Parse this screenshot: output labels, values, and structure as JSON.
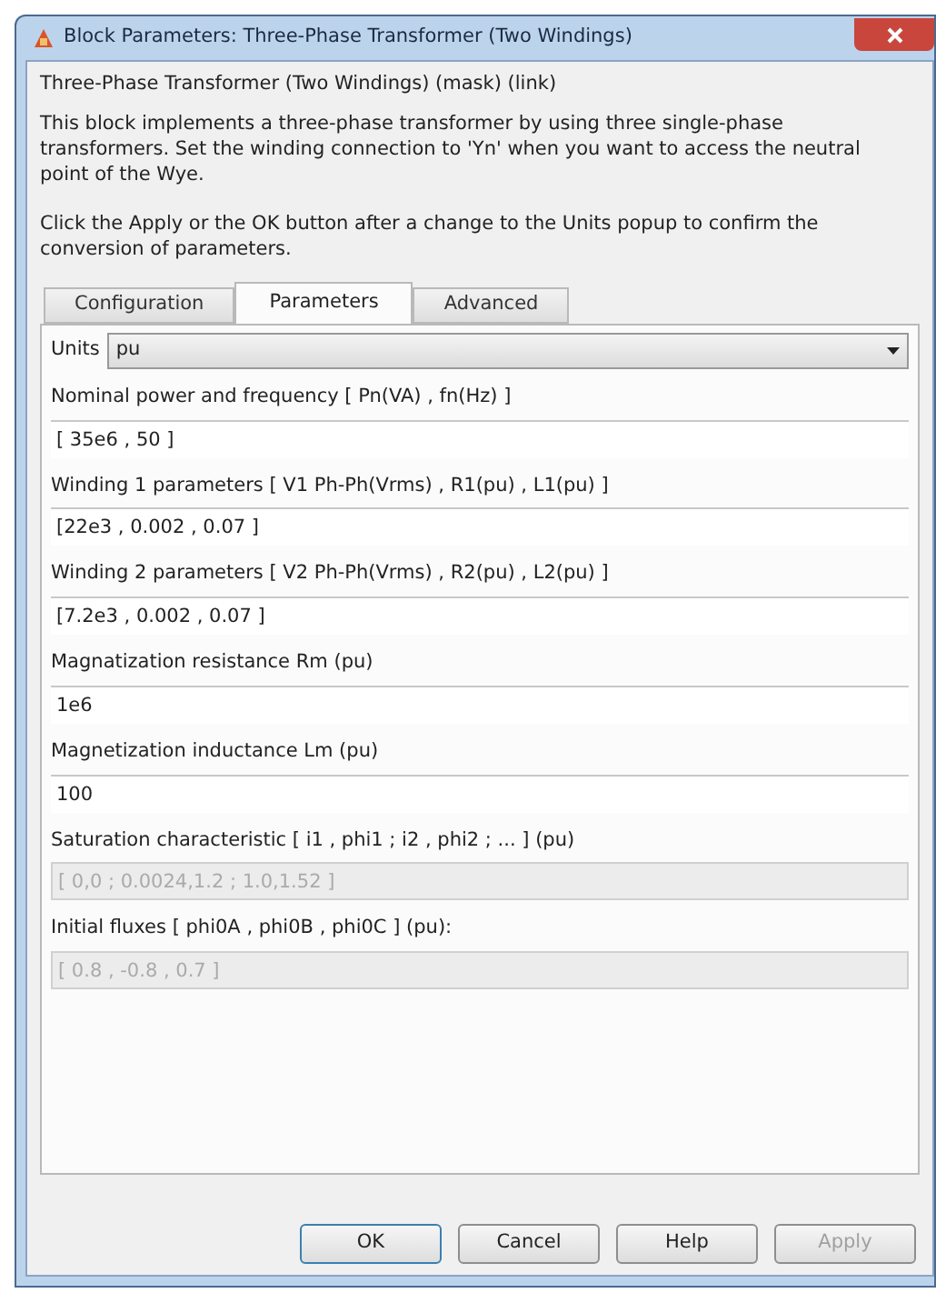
{
  "window": {
    "title": "Block Parameters: Three-Phase Transformer (Two Windings)"
  },
  "block_heading": "Three-Phase Transformer (Two Windings) (mask) (link)",
  "description": [
    "This block implements a three-phase transformer by using three single-phase transformers. Set the winding connection to 'Yn' when you want to access the neutral point of the Wye.",
    "Click the Apply or the OK button after a change to the Units popup to confirm the conversion of parameters."
  ],
  "tabs": [
    {
      "label": "Configuration",
      "selected": false
    },
    {
      "label": "Parameters",
      "selected": true
    },
    {
      "label": "Advanced",
      "selected": false
    }
  ],
  "units": {
    "label": "Units",
    "value": "pu"
  },
  "fields": [
    {
      "label": "Nominal power and frequency  [ Pn(VA) , fn(Hz) ]",
      "value": "[ 35e6 , 50 ]",
      "disabled": false
    },
    {
      "label": "Winding 1 parameters [ V1 Ph-Ph(Vrms) , R1(pu) , L1(pu) ]",
      "value": "[22e3 , 0.002 , 0.07 ]",
      "disabled": false
    },
    {
      "label": "Winding 2 parameters [ V2 Ph-Ph(Vrms) , R2(pu) , L2(pu) ]",
      "value": "[7.2e3 , 0.002 , 0.07 ]",
      "disabled": false
    },
    {
      "label": "Magnatization resistance  Rm (pu)",
      "value": "1e6",
      "disabled": false
    },
    {
      "label": "Magnetization inductance  Lm (pu)",
      "value": "100",
      "disabled": false
    },
    {
      "label": "Saturation characteristic [ i1 , phi1 ; i2 , phi2 ; ... ] (pu)",
      "value": "[ 0,0 ; 0.0024,1.2 ; 1.0,1.52 ]",
      "disabled": true
    },
    {
      "label": "Initial fluxes [ phi0A , phi0B , phi0C ] (pu):",
      "value": "[ 0.8 , -0.8 , 0.7 ]",
      "disabled": true
    }
  ],
  "buttons": [
    {
      "label": "OK",
      "disabled": false,
      "default": true
    },
    {
      "label": "Cancel",
      "disabled": false,
      "default": false
    },
    {
      "label": "Help",
      "disabled": false,
      "default": false
    },
    {
      "label": "Apply",
      "disabled": true,
      "default": false
    }
  ]
}
